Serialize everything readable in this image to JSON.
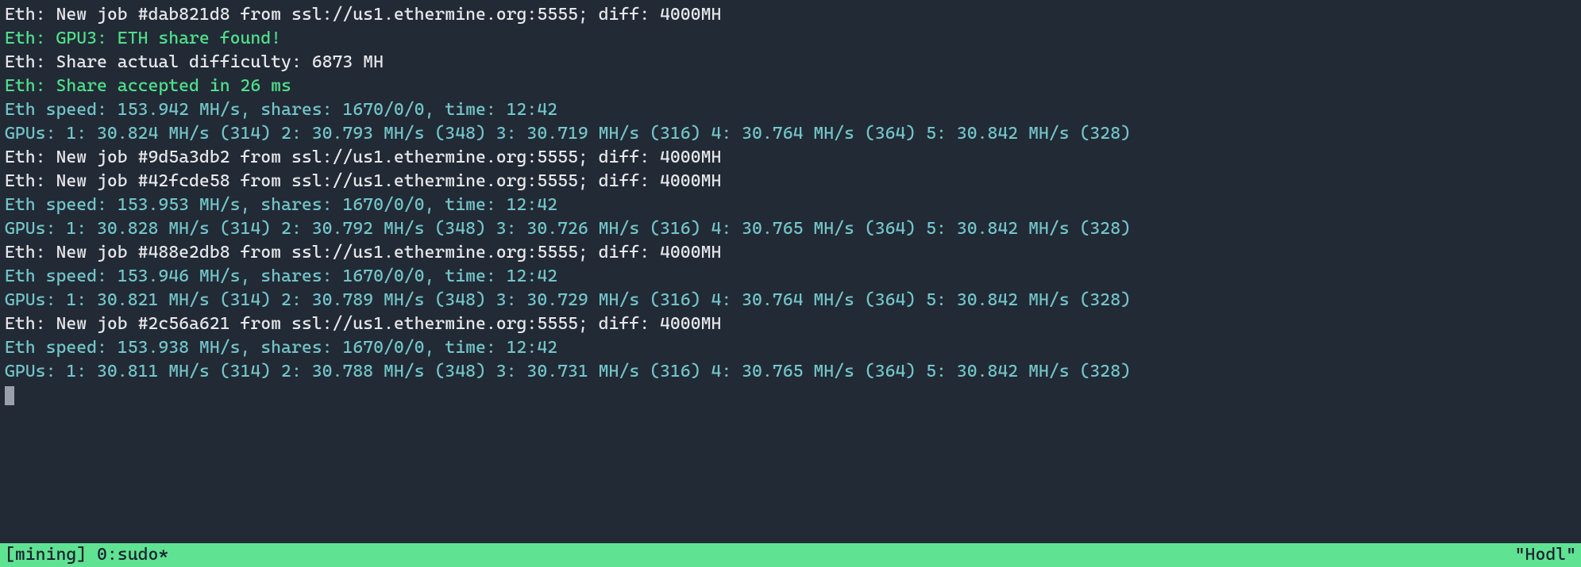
{
  "lines": [
    {
      "cls": "white",
      "text": "Eth: New job #dab821d8 from ssl://us1.ethermine.org:5555; diff: 4000MH"
    },
    {
      "cls": "green",
      "text": "Eth: GPU3: ETH share found!"
    },
    {
      "cls": "white",
      "text": "Eth: Share actual difficulty: 6873 MH"
    },
    {
      "cls": "green",
      "text": "Eth: Share accepted in 26 ms"
    },
    {
      "cls": "cyan",
      "text": "Eth speed: 153.942 MH/s, shares: 1670/0/0, time: 12:42"
    },
    {
      "cls": "cyan",
      "text": "GPUs: 1: 30.824 MH/s (314) 2: 30.793 MH/s (348) 3: 30.719 MH/s (316) 4: 30.764 MH/s (364) 5: 30.842 MH/s (328)"
    },
    {
      "cls": "white",
      "text": "Eth: New job #9d5a3db2 from ssl://us1.ethermine.org:5555; diff: 4000MH"
    },
    {
      "cls": "white",
      "text": "Eth: New job #42fcde58 from ssl://us1.ethermine.org:5555; diff: 4000MH"
    },
    {
      "cls": "cyan",
      "text": "Eth speed: 153.953 MH/s, shares: 1670/0/0, time: 12:42"
    },
    {
      "cls": "cyan",
      "text": "GPUs: 1: 30.828 MH/s (314) 2: 30.792 MH/s (348) 3: 30.726 MH/s (316) 4: 30.765 MH/s (364) 5: 30.842 MH/s (328)"
    },
    {
      "cls": "white",
      "text": "Eth: New job #488e2db8 from ssl://us1.ethermine.org:5555; diff: 4000MH"
    },
    {
      "cls": "cyan",
      "text": "Eth speed: 153.946 MH/s, shares: 1670/0/0, time: 12:42"
    },
    {
      "cls": "cyan",
      "text": "GPUs: 1: 30.821 MH/s (314) 2: 30.789 MH/s (348) 3: 30.729 MH/s (316) 4: 30.764 MH/s (364) 5: 30.842 MH/s (328)"
    },
    {
      "cls": "white",
      "text": "Eth: New job #2c56a621 from ssl://us1.ethermine.org:5555; diff: 4000MH"
    },
    {
      "cls": "cyan",
      "text": "Eth speed: 153.938 MH/s, shares: 1670/0/0, time: 12:42"
    },
    {
      "cls": "cyan",
      "text": "GPUs: 1: 30.811 MH/s (314) 2: 30.788 MH/s (348) 3: 30.731 MH/s (316) 4: 30.765 MH/s (364) 5: 30.842 MH/s (328)"
    }
  ],
  "statusbar": {
    "left": "[mining] 0:sudo*",
    "right": "\"Hodl\""
  }
}
